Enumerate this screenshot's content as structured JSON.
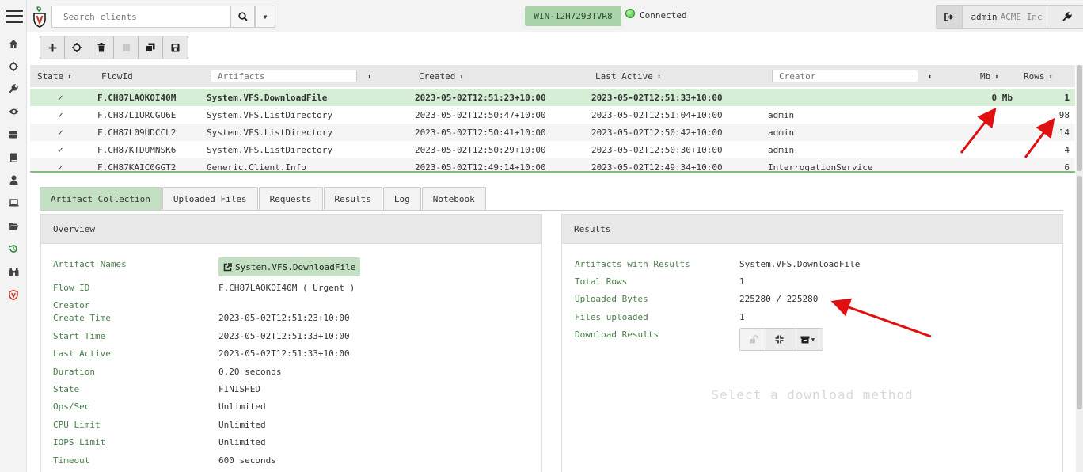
{
  "search": {
    "placeholder": "Search clients"
  },
  "header": {
    "client_id": "WIN-12H7293TVR8",
    "connection_status": "Connected",
    "user": "admin",
    "org": "ACME Inc"
  },
  "sidebar": {
    "items": [
      {
        "icon": "home-icon"
      },
      {
        "icon": "crosshair-icon"
      },
      {
        "icon": "wrench-icon"
      },
      {
        "icon": "eye-icon"
      },
      {
        "icon": "server-icon"
      },
      {
        "icon": "book-icon"
      },
      {
        "icon": "user-icon"
      },
      {
        "icon": "laptop-icon"
      },
      {
        "icon": "folder-open-icon"
      },
      {
        "icon": "history-icon"
      },
      {
        "icon": "binoculars-icon"
      },
      {
        "icon": "velociraptor-shield-icon"
      }
    ]
  },
  "toolbar": {
    "buttons": [
      {
        "icon": "plus-icon"
      },
      {
        "icon": "crosshair-icon"
      },
      {
        "icon": "trash-icon"
      },
      {
        "icon": "stop-icon",
        "disabled": true
      },
      {
        "icon": "copy-icon"
      },
      {
        "icon": "save-icon"
      }
    ]
  },
  "flows": {
    "columns": {
      "state": "State",
      "flow_id": "FlowId",
      "artifacts_placeholder": "Artifacts",
      "created": "Created",
      "last_active": "Last Active",
      "creator_placeholder": "Creator",
      "mb": "Mb",
      "rows": "Rows"
    },
    "rows": [
      {
        "state": "✓",
        "flow_id": "F.CH87LAOKOI40M",
        "artifact": "System.VFS.DownloadFile",
        "created": "2023-05-02T12:51:23+10:00",
        "last_active": "2023-05-02T12:51:33+10:00",
        "creator": "",
        "mb": "0 Mb",
        "rows": "1"
      },
      {
        "state": "✓",
        "flow_id": "F.CH87L1URCGU6E",
        "artifact": "System.VFS.ListDirectory",
        "created": "2023-05-02T12:50:47+10:00",
        "last_active": "2023-05-02T12:51:04+10:00",
        "creator": "admin",
        "mb": "",
        "rows": "98"
      },
      {
        "state": "✓",
        "flow_id": "F.CH87L09UDCCL2",
        "artifact": "System.VFS.ListDirectory",
        "created": "2023-05-02T12:50:41+10:00",
        "last_active": "2023-05-02T12:50:42+10:00",
        "creator": "admin",
        "mb": "",
        "rows": "14"
      },
      {
        "state": "✓",
        "flow_id": "F.CH87KTDUMNSK6",
        "artifact": "System.VFS.ListDirectory",
        "created": "2023-05-02T12:50:29+10:00",
        "last_active": "2023-05-02T12:50:30+10:00",
        "creator": "admin",
        "mb": "",
        "rows": "4"
      },
      {
        "state": "✓",
        "flow_id": "F.CH87KAIC0GGT2",
        "artifact": "Generic.Client.Info",
        "created": "2023-05-02T12:49:14+10:00",
        "last_active": "2023-05-02T12:49:34+10:00",
        "creator": "InterrogationService",
        "mb": "",
        "rows": "6"
      }
    ]
  },
  "tabs": [
    "Artifact Collection",
    "Uploaded Files",
    "Requests",
    "Results",
    "Log",
    "Notebook"
  ],
  "overview": {
    "title": "Overview",
    "fields": [
      {
        "label": "Artifact Names",
        "value": "System.VFS.DownloadFile"
      },
      {
        "label": "Flow ID",
        "value": "F.CH87LAOKOI40M ( Urgent )"
      },
      {
        "label": "Creator",
        "value": ""
      },
      {
        "label": "Create Time",
        "value": "2023-05-02T12:51:23+10:00"
      },
      {
        "label": "Start Time",
        "value": "2023-05-02T12:51:33+10:00"
      },
      {
        "label": "Last Active",
        "value": "2023-05-02T12:51:33+10:00"
      },
      {
        "label": "Duration",
        "value": "0.20 seconds"
      },
      {
        "label": "State",
        "value": "FINISHED"
      },
      {
        "label": "Ops/Sec",
        "value": "Unlimited"
      },
      {
        "label": "CPU Limit",
        "value": "Unlimited"
      },
      {
        "label": "IOPS Limit",
        "value": "Unlimited"
      },
      {
        "label": "Timeout",
        "value": "600 seconds"
      }
    ]
  },
  "results": {
    "title": "Results",
    "fields": [
      {
        "label": "Artifacts with Results",
        "value": "System.VFS.DownloadFile"
      },
      {
        "label": "Total Rows",
        "value": "1"
      },
      {
        "label": "Uploaded Bytes",
        "value": "225280 / 225280"
      },
      {
        "label": "Files uploaded",
        "value": "1"
      },
      {
        "label": "Download Results",
        "value": ""
      }
    ],
    "placeholder": "Select a download method"
  },
  "colors": {
    "accent_green": "#c3e0c3",
    "selected_row": "#d6edd6",
    "label_green": "#4a7d4a",
    "annotation_red": "#e01010"
  }
}
